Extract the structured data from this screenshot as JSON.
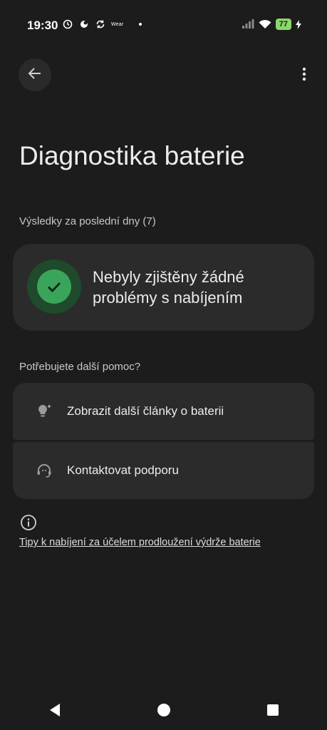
{
  "status_bar": {
    "time": "19:30",
    "wear_label": "Wear",
    "battery_level": "77",
    "icons": [
      "clock-alarm-icon",
      "weather-icon",
      "sync-icon",
      "wear-icon",
      "signal-icon",
      "wifi-icon",
      "battery-icon"
    ]
  },
  "header": {
    "back_icon": "arrow-left-icon",
    "more_icon": "more-vertical-icon"
  },
  "page": {
    "title": "Diagnostika baterie",
    "results_label": "Výsledky za poslední dny (7)",
    "result_message": "Nebyly zjištěny žádné problémy s nabíjením",
    "help_label": "Potřebujete další pomoc?",
    "help_items": [
      {
        "label": "Zobrazit další články o baterii",
        "icon": "lightbulb-icon"
      },
      {
        "label": "Kontaktovat podporu",
        "icon": "support-agent-icon"
      }
    ],
    "tips_link": "Tipy k nabíjení za účelem prodloužení výdrže baterie"
  },
  "colors": {
    "background": "#1c1c1c",
    "card": "#2b2b2b",
    "success_green": "#3aa55a",
    "battery_green": "#8bd86b"
  }
}
